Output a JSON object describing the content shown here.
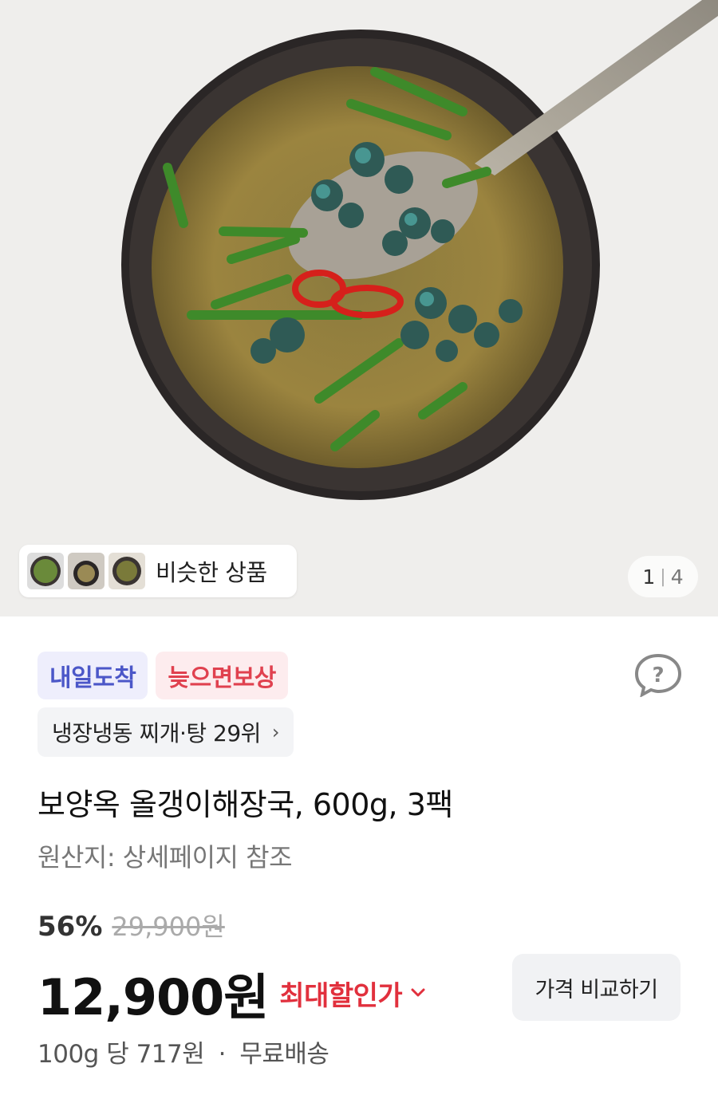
{
  "gallery": {
    "similar_label": "비슷한 상품",
    "current_page": "1",
    "page_separator": "|",
    "total_pages": "4"
  },
  "badges": {
    "delivery": "내일도착",
    "late_compensation": "늦으면보상"
  },
  "ranking": {
    "label": "냉장냉동 찌개·탕 29위",
    "chevron": "›"
  },
  "product": {
    "title": "보양옥 올갱이해장국, 600g, 3팩",
    "origin": "원산지: 상세페이지 참조"
  },
  "pricing": {
    "discount_rate": "56%",
    "original_price": "29,900원",
    "sale_price": "12,900원",
    "max_discount_label": "최대할인가",
    "compare_button": "가격 비교하기",
    "unit_price": "100g 당 717원",
    "separator": "·",
    "shipping": "무료배송"
  },
  "colors": {
    "delivery_badge_text": "#4b57c8",
    "compensation_badge_text": "#e0414f",
    "max_discount_text": "#e1303d"
  }
}
